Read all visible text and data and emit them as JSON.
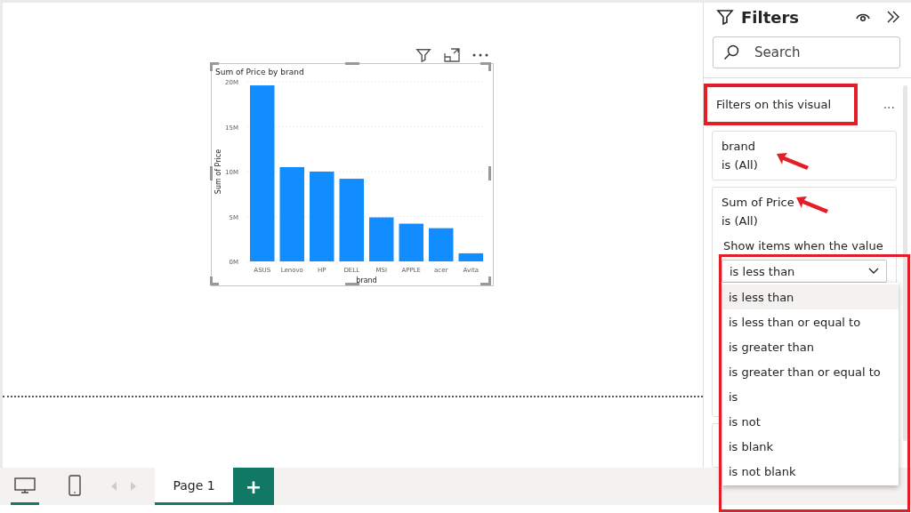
{
  "visual": {
    "chart_data": {
      "type": "bar",
      "title": "Sum of Price by brand",
      "xlabel": "brand",
      "ylabel": "Sum of Price",
      "categories": [
        "ASUS",
        "Lenovo",
        "HP",
        "DELL",
        "MSI",
        "APPLE",
        "acer",
        "Avita"
      ],
      "grid": true,
      "series": [
        {
          "color": "#118dff",
          "values": [
            19.6,
            10.5,
            10.0,
            9.2,
            4.9,
            4.2,
            3.7,
            0.9
          ]
        }
      ],
      "ylim": [
        0,
        20
      ],
      "yticks": [
        {
          "value": 0,
          "label": "0M"
        },
        {
          "value": 5,
          "label": "5M"
        },
        {
          "value": 10,
          "label": "10M"
        },
        {
          "value": 15,
          "label": "15M"
        },
        {
          "value": 20,
          "label": "20M"
        }
      ]
    }
  },
  "filters": {
    "title": "Filters",
    "search": {
      "placeholder": "Search"
    },
    "section": {
      "title": "Filters on this visual",
      "more": "...",
      "highlighted": true
    },
    "cards": [
      {
        "field": "brand",
        "summary": "is (All)",
        "arrow": true
      },
      {
        "field": "Sum of Price",
        "summary": "is (All)",
        "arrow": true,
        "prompt": "Show items when the value",
        "select": {
          "value": "is less than",
          "highlighted": true,
          "options": [
            {
              "label": "is less than",
              "selected": true
            },
            {
              "label": "is less than or equal to",
              "selected": false
            },
            {
              "label": "is greater than",
              "selected": false
            },
            {
              "label": "is greater than or equal to",
              "selected": false
            },
            {
              "label": "is",
              "selected": false
            },
            {
              "label": "is not",
              "selected": false
            },
            {
              "label": "is blank",
              "selected": false
            },
            {
              "label": "is not blank",
              "selected": false
            }
          ]
        }
      }
    ]
  },
  "bottom_bar": {
    "views": [
      {
        "kind": "desktop",
        "selected": true
      },
      {
        "kind": "mobile",
        "selected": false
      }
    ],
    "pages": [
      {
        "label": "Page 1",
        "selected": true
      }
    ],
    "add_label": "+"
  }
}
